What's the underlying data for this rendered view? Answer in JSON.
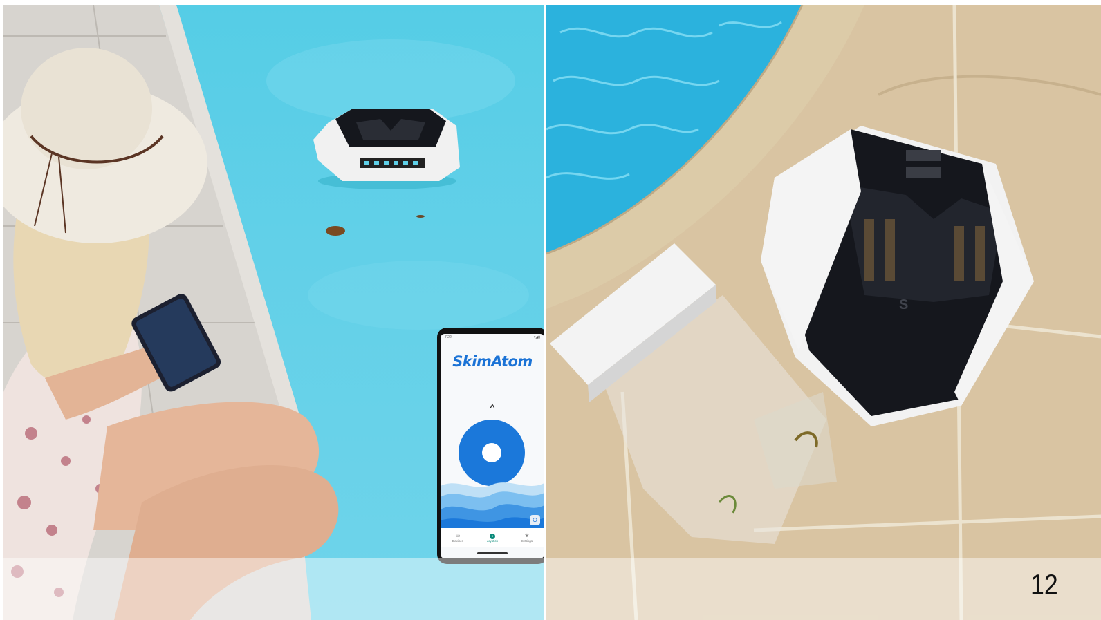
{
  "slide": {
    "page_number": "12"
  },
  "phone_app": {
    "title": "SkimAtom",
    "status_time": "7:22",
    "status_icons": "▾◢▮",
    "up_caret": "^",
    "fab_icon": "locate-icon",
    "nav": [
      {
        "label": "Devices",
        "icon": "device-icon"
      },
      {
        "label": "Joystick",
        "icon": "joystick-icon"
      },
      {
        "label": "Settings",
        "icon": "gear-icon"
      }
    ]
  },
  "colors": {
    "pool_water": "#5fd0e8",
    "app_blue": "#1b78da",
    "robot_black": "#14161c",
    "robot_white": "#eeeeee",
    "stone": "#d9c4a2"
  }
}
